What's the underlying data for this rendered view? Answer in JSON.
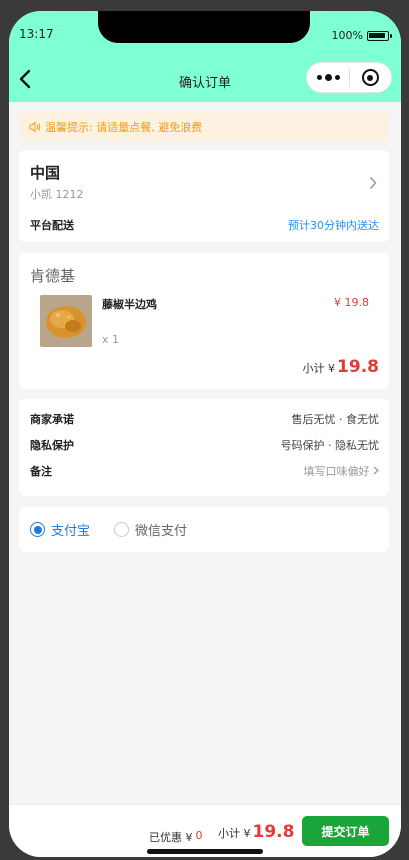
{
  "status": {
    "time": "13:17",
    "battery": "100%"
  },
  "nav": {
    "title": "确认订单"
  },
  "notice": {
    "text": "温馨提示: 请适量点餐, 避免浪费"
  },
  "address": {
    "country": "中国",
    "person": "小凯 1212",
    "delivery_label": "平台配送",
    "eta": "预计30分钟内送达"
  },
  "shop": {
    "name": "肯德基",
    "item": {
      "name": "藤椒半边鸡",
      "price": "¥ 19.8",
      "qty": "x 1"
    },
    "subtotal_label": "小计 ¥",
    "subtotal_value": "19.8"
  },
  "promises": [
    {
      "key": "商家承诺",
      "value": "售后无忧 · 食无忧"
    },
    {
      "key": "隐私保护",
      "value": "号码保护 · 隐私无忧"
    },
    {
      "key": "备注",
      "value": "填写口味偏好"
    }
  ],
  "payment": {
    "options": [
      "支付宝",
      "微信支付"
    ],
    "selected": "支付宝",
    "colors": {
      "selected": "#1e7ae6",
      "unselected": "#666666"
    }
  },
  "bottom": {
    "discount_label": "已优惠 ¥",
    "discount_value": "0",
    "total_label": "小计 ¥",
    "total_value": "19.8",
    "submit_label": "提交订单"
  },
  "colors": {
    "header": "#7fffd4",
    "price": "#e53935",
    "submit": "#1aa53a",
    "notice_text": "#f39c12",
    "eta": "#1e90ff"
  }
}
